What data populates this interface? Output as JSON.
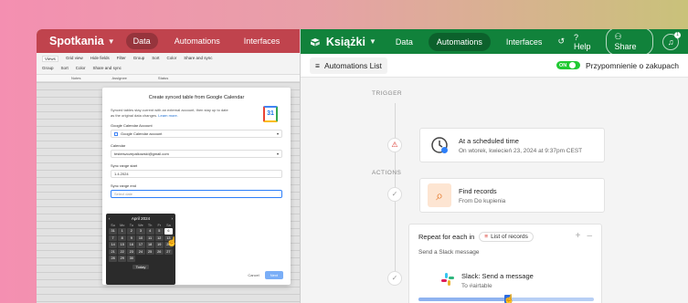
{
  "left": {
    "base_name": "Spotkania",
    "tabs": [
      {
        "label": "Data",
        "active": true
      },
      {
        "label": "Automations"
      },
      {
        "label": "Interfaces"
      }
    ],
    "toolbar_row1": [
      "Views",
      "Grid view",
      "Hide fields",
      "Filter",
      "Group",
      "Sort",
      "Color",
      "Share and sync"
    ],
    "toolbar_row2": [
      "Group",
      "Sort",
      "Color",
      "Share and sync"
    ],
    "columns": [
      "Notes",
      "Assignee",
      "Status"
    ],
    "modal": {
      "title": "Create synced table from Google Calendar",
      "desc": "Synced tables stay current with an external account, then stay up to date as the original data changes.",
      "learn_more": "Learn more.",
      "gcal_icon": "31",
      "account_label": "Google Calendar Account",
      "account_value": "Google Calendar account",
      "calendar_label": "Calendar",
      "calendar_value": "testerszczepalkowski@gmail.com",
      "start_label": "Sync range start",
      "start_value": "1.4.2024",
      "end_label": "Sync range end",
      "end_placeholder": "Select date",
      "cancel": "Cancel",
      "next": "Next"
    },
    "calendar": {
      "month": "April 2024",
      "prev": "‹",
      "next": "›",
      "dow": [
        "Su",
        "Mo",
        "Tu",
        "We",
        "Th",
        "Fr",
        "Sa"
      ],
      "days": [
        "31",
        "1",
        "2",
        "3",
        "4",
        "5",
        "6",
        "7",
        "8",
        "9",
        "10",
        "11",
        "12",
        "13",
        "14",
        "15",
        "16",
        "17",
        "18",
        "19",
        "20",
        "21",
        "22",
        "23",
        "24",
        "25",
        "26",
        "27",
        "28",
        "29",
        "30",
        "",
        "",
        "",
        ""
      ],
      "selected": "6",
      "today_label": "Today"
    }
  },
  "right": {
    "base_name": "Książki",
    "tabs": [
      {
        "label": "Data"
      },
      {
        "label": "Automations",
        "active": true
      },
      {
        "label": "Interfaces"
      }
    ],
    "help": "Help",
    "share": "Share",
    "notif_count": "1",
    "list_button": "Automations List",
    "toggle_state": "ON",
    "automation_name": "Przypomnienie o zakupach",
    "trigger_label": "TRIGGER",
    "actions_label": "ACTIONS",
    "trigger_card": {
      "title": "At a scheduled time",
      "sub": "On wtorek, kwiecień 23, 2024 at 9:37pm CEST"
    },
    "find_card": {
      "title": "Find records",
      "sub": "From Do kupienia"
    },
    "repeat": {
      "title": "Repeat for each in",
      "chip": "List of records",
      "sub": "Send a Slack message",
      "plus": "+",
      "minus": "–"
    },
    "slack": {
      "title": "Slack: Send a message",
      "sub": "To #airtable"
    },
    "progress_fraction": 0.5
  },
  "colors": {
    "left_accent": "#c0434d",
    "right_accent": "#11823b",
    "toggle": "#20c933",
    "progress": "#2d6cdf"
  }
}
